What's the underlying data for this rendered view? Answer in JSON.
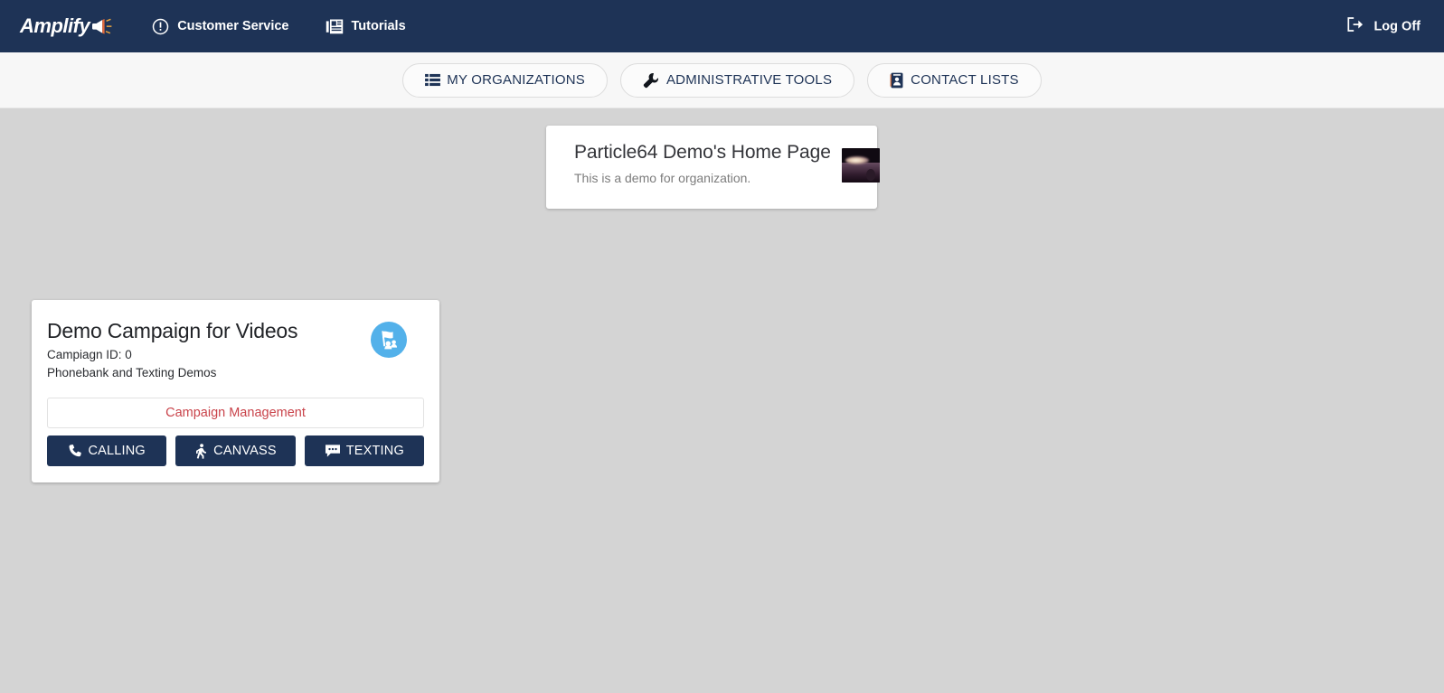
{
  "header": {
    "logo_text": "Amplify",
    "logo_icon": "megaphone-icon",
    "nav": [
      {
        "label": "Customer Service",
        "icon": "exclamation-circle-icon"
      },
      {
        "label": "Tutorials",
        "icon": "newspaper-icon"
      }
    ],
    "logoff_label": "Log Off",
    "logoff_icon": "sign-out-icon",
    "background_color": "#1e3356"
  },
  "subnav": {
    "background_color": "#f7f7f7",
    "items": [
      {
        "label": "MY ORGANIZATIONS",
        "icon": "list-icon"
      },
      {
        "label": "ADMINISTRATIVE TOOLS",
        "icon": "wrench-icon"
      },
      {
        "label": "CONTACT LISTS",
        "icon": "id-card-icon"
      }
    ]
  },
  "main": {
    "background_color": "#d4d4d4",
    "organization_card": {
      "title": "Particle64 Demo's Home Page",
      "description": "This is a demo for organization.",
      "thumbnail_alt": "organization-thumbnail"
    },
    "campaign_card": {
      "title": "Demo Campaign for Videos",
      "campaign_id_label": "Campiagn ID: 0",
      "description": "Phonebank and Texting Demos",
      "badge_icon": "campaign-flag-people-icon",
      "badge_color": "#53b1ea",
      "management_button": {
        "label": "Campaign Management",
        "text_color": "#c9434a"
      },
      "actions": [
        {
          "label": "CALLING",
          "icon": "phone-icon"
        },
        {
          "label": "CANVASS",
          "icon": "walking-person-icon"
        },
        {
          "label": "TEXTING",
          "icon": "comment-dots-icon"
        }
      ],
      "action_color": "#1e3356"
    }
  }
}
